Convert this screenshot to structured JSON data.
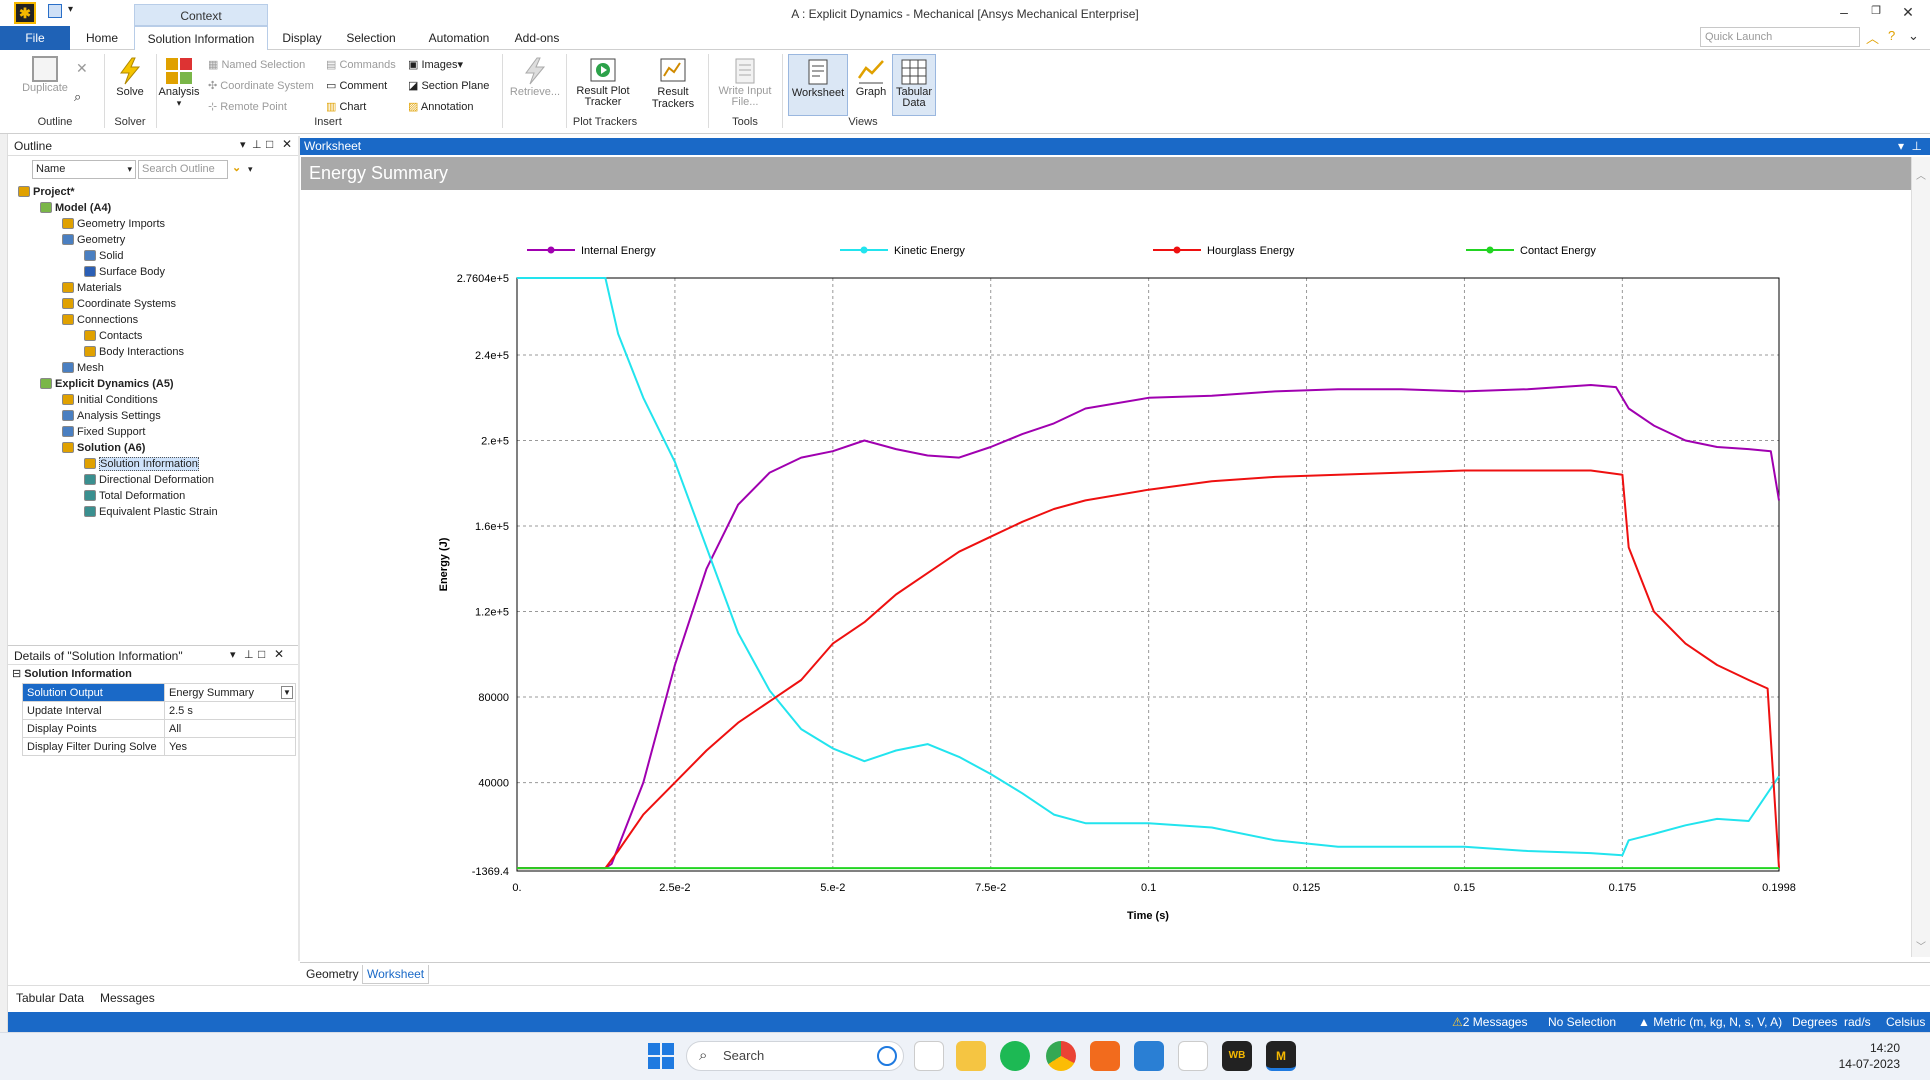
{
  "window": {
    "title": "A : Explicit Dynamics - Mechanical [Ansys Mechanical Enterprise]",
    "quick_launch_placeholder": "Quick Launch"
  },
  "ribbon_tabs": {
    "context_label": "Context",
    "file": "File",
    "home": "Home",
    "solution_information": "Solution Information",
    "display": "Display",
    "selection": "Selection",
    "automation": "Automation",
    "addons": "Add-ons"
  },
  "ribbon": {
    "outline": {
      "duplicate": "Duplicate",
      "group": "Outline"
    },
    "solver": {
      "solve": "Solve",
      "group": "Solver"
    },
    "insert": {
      "analysis": "Analysis",
      "named_selection": "Named Selection",
      "coordinate_system": "Coordinate System",
      "remote_point": "Remote Point",
      "commands": "Commands",
      "comment": "Comment",
      "chart": "Chart",
      "images": "Images",
      "section_plane": "Section Plane",
      "annotation": "Annotation",
      "group": "Insert"
    },
    "retrieve": "Retrieve...",
    "plot_trackers": {
      "result_plot_tracker": "Result Plot Tracker",
      "result_trackers": "Result Trackers",
      "group": "Plot Trackers"
    },
    "tools": {
      "write_input_file": "Write Input File...",
      "group": "Tools"
    },
    "views": {
      "worksheet": "Worksheet",
      "graph": "Graph",
      "tabular_data": "Tabular Data",
      "group": "Views"
    }
  },
  "outline": {
    "header": "Outline",
    "name_filter": "Name",
    "search_placeholder": "Search Outline",
    "tree": [
      {
        "label": "Project*",
        "level": 0,
        "bold": true,
        "icon": "project-icon",
        "color": "#e0a100"
      },
      {
        "label": "Model (A4)",
        "level": 1,
        "bold": true,
        "icon": "model-icon",
        "color": "#7ab648"
      },
      {
        "label": "Geometry Imports",
        "level": 2,
        "bold": false,
        "icon": "geometry-imports-icon",
        "color": "#e0a100"
      },
      {
        "label": "Geometry",
        "level": 2,
        "bold": false,
        "icon": "geometry-icon",
        "color": "#4a7fc1"
      },
      {
        "label": "Solid",
        "level": 3,
        "bold": false,
        "icon": "solid-icon",
        "color": "#4a7fc1"
      },
      {
        "label": "Surface Body",
        "level": 3,
        "bold": false,
        "icon": "surface-body-icon",
        "color": "#2b5fb5"
      },
      {
        "label": "Materials",
        "level": 2,
        "bold": false,
        "icon": "materials-icon",
        "color": "#e0a100"
      },
      {
        "label": "Coordinate Systems",
        "level": 2,
        "bold": false,
        "icon": "coordinate-systems-icon",
        "color": "#e0a100"
      },
      {
        "label": "Connections",
        "level": 2,
        "bold": false,
        "icon": "connections-icon",
        "color": "#e0a100"
      },
      {
        "label": "Contacts",
        "level": 3,
        "bold": false,
        "icon": "contacts-icon",
        "color": "#e0a100"
      },
      {
        "label": "Body Interactions",
        "level": 3,
        "bold": false,
        "icon": "body-interactions-icon",
        "color": "#e0a100"
      },
      {
        "label": "Mesh",
        "level": 2,
        "bold": false,
        "icon": "mesh-icon",
        "color": "#4a7fc1"
      },
      {
        "label": "Explicit Dynamics (A5)",
        "level": 1,
        "bold": true,
        "icon": "explicit-dynamics-icon",
        "color": "#7ab648"
      },
      {
        "label": "Initial Conditions",
        "level": 2,
        "bold": false,
        "icon": "initial-conditions-icon",
        "color": "#e0a100"
      },
      {
        "label": "Analysis Settings",
        "level": 2,
        "bold": false,
        "icon": "analysis-settings-icon",
        "color": "#4a7fc1"
      },
      {
        "label": "Fixed Support",
        "level": 2,
        "bold": false,
        "icon": "fixed-support-icon",
        "color": "#4a7fc1"
      },
      {
        "label": "Solution (A6)",
        "level": 2,
        "bold": true,
        "icon": "solution-icon",
        "color": "#e0a100"
      },
      {
        "label": "Solution Information",
        "level": 3,
        "bold": false,
        "icon": "solution-information-icon",
        "color": "#e0a100",
        "selected": true
      },
      {
        "label": "Directional Deformation",
        "level": 3,
        "bold": false,
        "icon": "directional-deformation-icon",
        "color": "#3a8f8f"
      },
      {
        "label": "Total Deformation",
        "level": 3,
        "bold": false,
        "icon": "total-deformation-icon",
        "color": "#3a8f8f"
      },
      {
        "label": "Equivalent Plastic Strain",
        "level": 3,
        "bold": false,
        "icon": "equivalent-plastic-strain-icon",
        "color": "#3a8f8f"
      }
    ]
  },
  "details": {
    "header": "Details of \"Solution Information\"",
    "section": "Solution Information",
    "rows": [
      {
        "key": "Solution Output",
        "value": "Energy Summary"
      },
      {
        "key": "Update Interval",
        "value": "2.5 s"
      },
      {
        "key": "Display Points",
        "value": "All"
      },
      {
        "key": "Display Filter During Solve",
        "value": "Yes"
      }
    ]
  },
  "worksheet": {
    "bar_label": "Worksheet",
    "title": "Energy Summary",
    "bottom_tabs": [
      "Geometry",
      "Worksheet"
    ]
  },
  "chart_data": {
    "type": "line",
    "title": "",
    "xlabel": "Time (s)",
    "ylabel": "Energy (J)",
    "xlim": [
      0,
      0.1998
    ],
    "ylim": [
      -1369.4,
      276040
    ],
    "x_ticks": [
      "0.",
      "2.5e-2",
      "5.e-2",
      "7.5e-2",
      "0.1",
      "0.125",
      "0.15",
      "0.175",
      "0.1998"
    ],
    "y_ticks": [
      "-1369.4",
      "40000",
      "80000",
      "1.2e+5",
      "1.6e+5",
      "2.e+5",
      "2.4e+5",
      "2.7604e+5"
    ],
    "legend_position": "top",
    "grid": true,
    "series": [
      {
        "name": "Internal Energy",
        "color": "#a000b0",
        "x": [
          0,
          0.014,
          0.015,
          0.02,
          0.025,
          0.03,
          0.035,
          0.04,
          0.045,
          0.05,
          0.055,
          0.06,
          0.065,
          0.07,
          0.075,
          0.08,
          0.085,
          0.09,
          0.1,
          0.11,
          0.12,
          0.13,
          0.14,
          0.15,
          0.16,
          0.17,
          0.174,
          0.176,
          0.18,
          0.185,
          0.19,
          0.195,
          0.1985,
          0.1998
        ],
        "y": [
          0,
          0,
          2000,
          40000,
          95000,
          140000,
          170000,
          185000,
          192000,
          195000,
          200000,
          196000,
          193000,
          192000,
          197000,
          203000,
          208000,
          215000,
          220000,
          221000,
          223000,
          224000,
          224000,
          223000,
          224000,
          226000,
          225000,
          215000,
          207000,
          200000,
          197000,
          196000,
          195000,
          172000
        ]
      },
      {
        "name": "Kinetic Energy",
        "color": "#22e4ee",
        "x": [
          0,
          0.014,
          0.016,
          0.02,
          0.025,
          0.03,
          0.035,
          0.04,
          0.045,
          0.05,
          0.055,
          0.06,
          0.065,
          0.07,
          0.075,
          0.08,
          0.085,
          0.09,
          0.1,
          0.11,
          0.12,
          0.13,
          0.14,
          0.15,
          0.16,
          0.17,
          0.175,
          0.176,
          0.18,
          0.185,
          0.19,
          0.195,
          0.1998
        ],
        "y": [
          276040,
          276040,
          250000,
          220000,
          190000,
          150000,
          110000,
          83000,
          65000,
          56000,
          50000,
          55000,
          58000,
          52000,
          44000,
          35000,
          25000,
          21000,
          21000,
          19000,
          13000,
          10000,
          10000,
          10000,
          8000,
          7000,
          6000,
          13000,
          16000,
          20000,
          23000,
          22000,
          43000
        ]
      },
      {
        "name": "Hourglass Energy",
        "color": "#ee1010",
        "x": [
          0,
          0.014,
          0.016,
          0.02,
          0.025,
          0.03,
          0.035,
          0.04,
          0.045,
          0.05,
          0.055,
          0.06,
          0.065,
          0.07,
          0.075,
          0.08,
          0.085,
          0.09,
          0.1,
          0.11,
          0.12,
          0.13,
          0.14,
          0.15,
          0.16,
          0.17,
          0.175,
          0.176,
          0.18,
          0.185,
          0.19,
          0.195,
          0.198,
          0.1998
        ],
        "y": [
          0,
          0,
          8000,
          25000,
          40000,
          55000,
          68000,
          78000,
          88000,
          105000,
          115000,
          128000,
          138000,
          148000,
          155000,
          162000,
          168000,
          172000,
          177000,
          181000,
          183000,
          184000,
          185000,
          186000,
          186000,
          186000,
          184000,
          150000,
          120000,
          105000,
          95000,
          88000,
          84000,
          0
        ]
      },
      {
        "name": "Contact Energy",
        "color": "#22d422",
        "x": [
          0,
          0.1998
        ],
        "y": [
          0,
          0
        ]
      }
    ]
  },
  "status_bar": {
    "messages": "2 Messages",
    "selection": "No Selection",
    "units": "Metric (m, kg, N, s, V, A)",
    "angle": "Degrees",
    "angular_velocity": "rad/s",
    "temperature": "Celsius"
  },
  "taskbar": {
    "search_placeholder": "Search",
    "time": "14:20",
    "date": "14-07-2023"
  }
}
